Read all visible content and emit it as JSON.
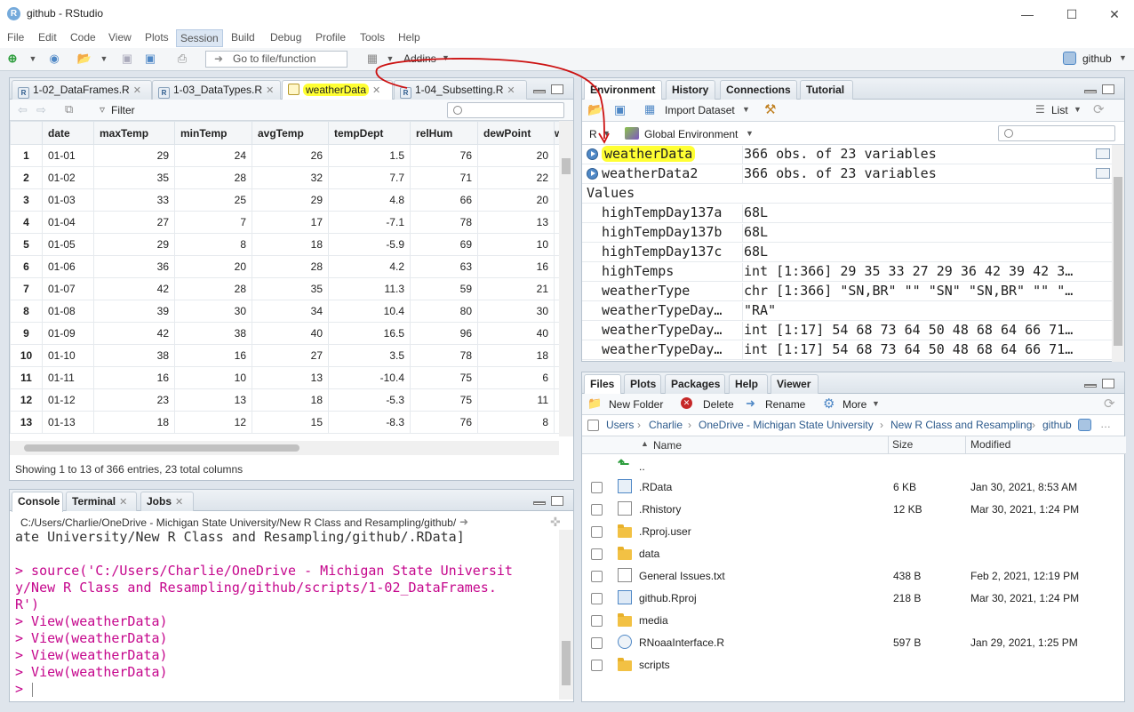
{
  "window": {
    "title": "github - RStudio",
    "project": "github"
  },
  "menu": [
    "File",
    "Edit",
    "Code",
    "View",
    "Plots",
    "Session",
    "Build",
    "Debug",
    "Profile",
    "Tools",
    "Help"
  ],
  "toolbar": {
    "goto_placeholder": "Go to file/function",
    "addins": "Addins"
  },
  "source": {
    "tabs": [
      "1-02_DataFrames.R",
      "1-03_DataTypes.R",
      "weatherData",
      "1-04_Subsetting.R"
    ],
    "filter": "Filter",
    "columns": [
      "date",
      "maxTemp",
      "minTemp",
      "avgTemp",
      "tempDept",
      "relHum",
      "dewPoint",
      "we"
    ],
    "rows": [
      [
        "1",
        "01-01",
        "29",
        "24",
        "26",
        "1.5",
        "76",
        "20"
      ],
      [
        "2",
        "01-02",
        "35",
        "28",
        "32",
        "7.7",
        "71",
        "22"
      ],
      [
        "3",
        "01-03",
        "33",
        "25",
        "29",
        "4.8",
        "66",
        "20"
      ],
      [
        "4",
        "01-04",
        "27",
        "7",
        "17",
        "-7.1",
        "78",
        "13"
      ],
      [
        "5",
        "01-05",
        "29",
        "8",
        "18",
        "-5.9",
        "69",
        "10"
      ],
      [
        "6",
        "01-06",
        "36",
        "20",
        "28",
        "4.2",
        "63",
        "16"
      ],
      [
        "7",
        "01-07",
        "42",
        "28",
        "35",
        "11.3",
        "59",
        "21"
      ],
      [
        "8",
        "01-08",
        "39",
        "30",
        "34",
        "10.4",
        "80",
        "30"
      ],
      [
        "9",
        "01-09",
        "42",
        "38",
        "40",
        "16.5",
        "96",
        "40"
      ],
      [
        "10",
        "01-10",
        "38",
        "16",
        "27",
        "3.5",
        "78",
        "18"
      ],
      [
        "11",
        "01-11",
        "16",
        "10",
        "13",
        "-10.4",
        "75",
        "6"
      ],
      [
        "12",
        "01-12",
        "23",
        "13",
        "18",
        "-5.3",
        "75",
        "11"
      ],
      [
        "13",
        "01-13",
        "18",
        "12",
        "15",
        "-8.3",
        "76",
        "8"
      ]
    ],
    "status": "Showing 1 to 13 of 366 entries, 23 total columns"
  },
  "console": {
    "tabs": [
      "Console",
      "Terminal",
      "Jobs"
    ],
    "path": "C:/Users/Charlie/OneDrive - Michigan State University/New R Class and Resampling/github/",
    "lines": [
      "ate University/New R Class and Resampling/github/.RData]",
      "",
      "> source('C:/Users/Charlie/OneDrive - Michigan State Universit",
      "y/New R Class and Resampling/github/scripts/1-02_DataFrames.",
      "R')",
      "> View(weatherData)",
      "> View(weatherData)",
      "> View(weatherData)",
      "> View(weatherData)",
      "> "
    ]
  },
  "environment": {
    "tabs": [
      "Environment",
      "History",
      "Connections",
      "Tutorial"
    ],
    "import": "Import Dataset",
    "view_mode": "List",
    "lang": "R",
    "scope": "Global Environment",
    "data": [
      {
        "name": "weatherData",
        "value": "366 obs. of 23 variables"
      },
      {
        "name": "weatherData2",
        "value": "366 obs. of 23 variables"
      }
    ],
    "values_header": "Values",
    "values": [
      {
        "name": "highTempDay137a",
        "value": "68L"
      },
      {
        "name": "highTempDay137b",
        "value": "68L"
      },
      {
        "name": "highTempDay137c",
        "value": "68L"
      },
      {
        "name": "highTemps",
        "value": "int [1:366] 29 35 33 27 29 36 42 39 42 3…"
      },
      {
        "name": "weatherType",
        "value": "chr [1:366] \"SN,BR\" \"\" \"SN\" \"SN,BR\" \"\" \"…"
      },
      {
        "name": "weatherTypeDay…",
        "value": "\"RA\""
      },
      {
        "name": "weatherTypeDay…",
        "value": "int [1:17] 54 68 73 64 50 48 68 64 66 71…"
      },
      {
        "name": "weatherTypeDay…",
        "value": "int [1:17] 54 68 73 64 50 48 68 64 66 71…"
      }
    ]
  },
  "files": {
    "tabs": [
      "Files",
      "Plots",
      "Packages",
      "Help",
      "Viewer"
    ],
    "actions": [
      "New Folder",
      "Delete",
      "Rename",
      "More"
    ],
    "breadcrumb": [
      "Users",
      "Charlie",
      "OneDrive - Michigan State University",
      "New R Class and Resampling",
      "github"
    ],
    "headers": [
      "Name",
      "Size",
      "Modified"
    ],
    "up": "..",
    "items": [
      {
        "name": ".RData",
        "size": "6 KB",
        "modified": "Jan 30, 2021, 8:53 AM",
        "icon": "rdata-icon"
      },
      {
        "name": ".Rhistory",
        "size": "12 KB",
        "modified": "Mar 30, 2021, 1:24 PM",
        "icon": "history-file-icon"
      },
      {
        "name": ".Rproj.user",
        "size": "",
        "modified": "",
        "icon": "folder-icon"
      },
      {
        "name": "data",
        "size": "",
        "modified": "",
        "icon": "folder-icon"
      },
      {
        "name": "General Issues.txt",
        "size": "438 B",
        "modified": "Feb 2, 2021, 12:19 PM",
        "icon": "text-file-icon"
      },
      {
        "name": "github.Rproj",
        "size": "218 B",
        "modified": "Mar 30, 2021, 1:24 PM",
        "icon": "rproj-icon"
      },
      {
        "name": "media",
        "size": "",
        "modified": "",
        "icon": "folder-icon"
      },
      {
        "name": "RNoaaInterface.R",
        "size": "597 B",
        "modified": "Jan 29, 2021, 1:25 PM",
        "icon": "r-script-icon"
      },
      {
        "name": "scripts",
        "size": "",
        "modified": "",
        "icon": "folder-icon"
      }
    ]
  },
  "colors": {
    "highlight": "#ffff33",
    "arrow": "#cc1111",
    "console_text": "#c5068c"
  }
}
